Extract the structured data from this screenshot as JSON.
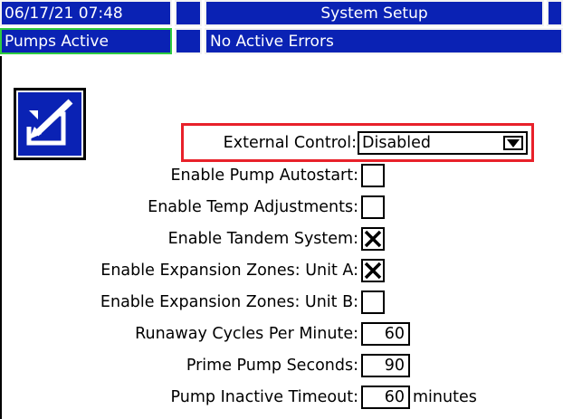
{
  "header": {
    "datetime": "06/17/21 07:48",
    "screen_title": "System Setup",
    "status": "Pumps Active",
    "errors": "No Active Errors"
  },
  "colors": {
    "bar": "#0a22b4",
    "status_border": "#2ecc40",
    "highlight": "#e8212a"
  },
  "form": {
    "external_control": {
      "label": "External Control:",
      "value": "Disabled"
    },
    "pump_autostart": {
      "label": "Enable Pump Autostart:",
      "checked": false
    },
    "temp_adjustments": {
      "label": "Enable Temp Adjustments:",
      "checked": false
    },
    "tandem_system": {
      "label": "Enable Tandem System:",
      "checked": true
    },
    "expansion_a": {
      "label": "Enable Expansion Zones: Unit A:",
      "checked": true
    },
    "expansion_b": {
      "label": "Enable Expansion Zones: Unit B:",
      "checked": false
    },
    "runaway_cycles": {
      "label": "Runaway Cycles Per Minute:",
      "value": "60"
    },
    "prime_seconds": {
      "label": "Prime Pump Seconds:",
      "value": "90"
    },
    "inactive_timeout": {
      "label": "Pump Inactive Timeout:",
      "value": "60",
      "unit": "minutes"
    }
  },
  "icons": {
    "setup_button": "edit-pencil-icon",
    "dropdown": "triangle-down-icon",
    "checkbox_checked": "x-mark-icon"
  }
}
